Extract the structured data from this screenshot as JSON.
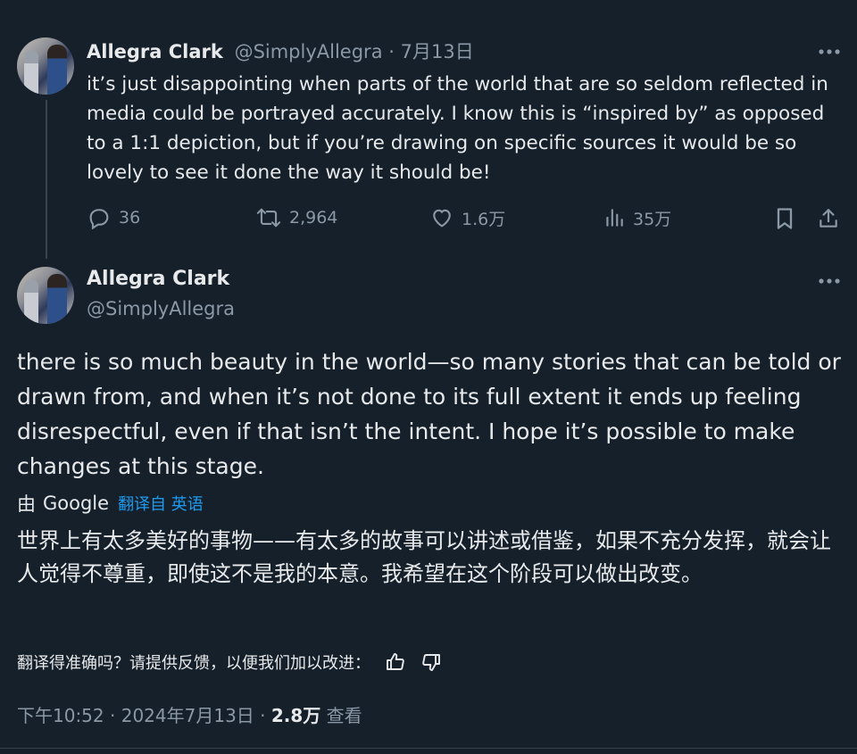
{
  "tweet1": {
    "author_name": "Allegra Clark",
    "handle": "@SimplyAllegra",
    "separator": " · ",
    "date": "7月13日",
    "text": "it’s just disappointing when parts of the world that are so seldom reflected in media could be portrayed accurately. I know this is “inspired by” as opposed to a 1:1 depiction, but if you’re drawing on specific sources it would be so lovely to see it done the way it should be!",
    "replies": "36",
    "retweets": "2,964",
    "likes": "1.6万",
    "views": "35万",
    "more_icon": "more-horizontal-icon"
  },
  "tweet2": {
    "author_name": "Allegra Clark",
    "handle": "@SimplyAllegra",
    "text": "there is so much beauty in the world—so many stories that can be told or drawn from, and when it’s not done to its full extent it ends up feeling disrespectful, even if that isn’t the intent. I hope it’s possible to make changes at this stage.",
    "translated_by_prefix": "由",
    "translated_by_brand": "Google",
    "translated_from_link": "翻译自 英语",
    "translation": "世界上有太多美好的事物——有太多的故事可以讲述或借鉴，如果不充分发挥，就会让人觉得不尊重，即使这不是我的本意。我希望在这个阶段可以做出改变。",
    "feedback_prompt": "翻译得准确吗？请提供反馈，以便我们加以改进：",
    "time": "下午10:52",
    "separator": " · ",
    "date": "2024年7月13日",
    "separator2": " · ",
    "views_count": "2.8万",
    "views_label": " 查看",
    "more_icon": "more-horizontal-icon"
  },
  "colors": {
    "background": "#15202b",
    "text": "#e7e9ea",
    "muted": "#8b98a5",
    "link": "#1d9bf0",
    "border": "#38444d"
  }
}
